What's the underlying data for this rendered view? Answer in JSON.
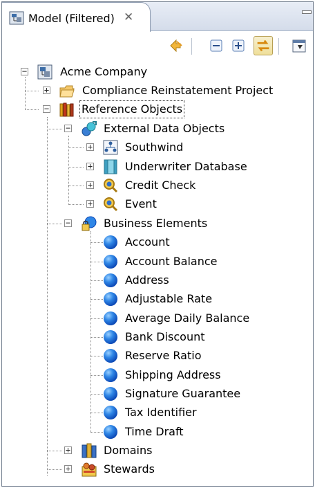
{
  "view": {
    "tab_title": "Model (Filtered)",
    "tab_close_glyph": "✕"
  },
  "toolbar": {
    "buttons": [
      {
        "name": "sync-icon"
      },
      {
        "name": "collapse-all-icon"
      },
      {
        "name": "expand-all-icon"
      },
      {
        "name": "link-with-editor-icon",
        "active": true
      },
      {
        "name": "view-menu-icon"
      }
    ]
  },
  "tree": {
    "root": {
      "label": "Acme Company",
      "expanded": true,
      "icon": "company-icon"
    },
    "project": {
      "label": "Compliance Reinstatement Project",
      "expanded": false,
      "icon": "project-folder-icon"
    },
    "reference_objects": {
      "label": "Reference Objects",
      "expanded": true,
      "icon": "books-icon"
    },
    "external_data_objects": {
      "label": "External Data Objects",
      "expanded": true,
      "icon": "external-data-icon"
    },
    "external_items": [
      {
        "label": "Southwind",
        "icon": "network-node-icon"
      },
      {
        "label": "Underwriter Database",
        "icon": "database-table-icon"
      },
      {
        "label": "Credit Check",
        "icon": "magnifier-icon"
      },
      {
        "label": "Event",
        "icon": "magnifier-icon"
      }
    ],
    "business_elements": {
      "label": "Business Elements",
      "expanded": true,
      "icon": "business-elements-icon"
    },
    "business_items": [
      "Account",
      "Account Balance",
      "Address",
      "Adjustable Rate",
      "Average Daily Balance",
      "Bank Discount",
      "Reserve Ratio",
      "Shipping Address",
      "Signature Guarantee",
      "Tax Identifier",
      "Time Draft"
    ],
    "domains": {
      "label": "Domains",
      "expanded": false,
      "icon": "domains-icon"
    },
    "stewards": {
      "label": "Stewards",
      "expanded": false,
      "icon": "stewards-icon"
    }
  },
  "colors": {
    "tab_border": "#8d9bb0",
    "tree_line": "#8c8c8c",
    "sphere_blue": "#2f86e6"
  }
}
